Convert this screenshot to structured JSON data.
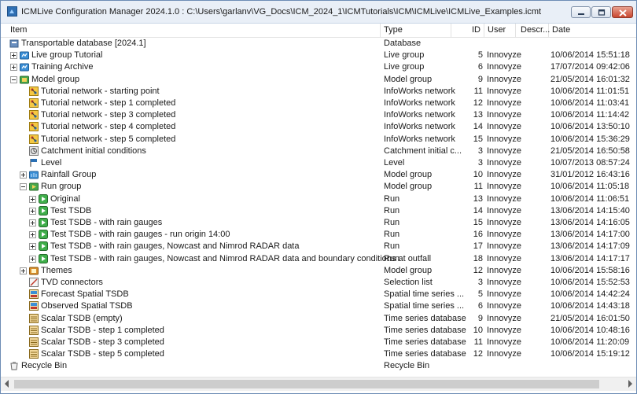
{
  "window": {
    "title": "ICMLive Configuration Manager 2024.1.0 : C:\\Users\\garlanv\\VG_Docs\\ICM_2024_1\\ICMTutorials\\ICM\\ICMLive\\ICMLive_Examples.icmt"
  },
  "columns": {
    "item": "Item",
    "type": "Type",
    "id": "ID",
    "user": "User",
    "description": "Descr...",
    "date": "Date"
  },
  "rows": [
    {
      "indent": 0,
      "expander": "none",
      "icon": "database-icon",
      "name": "Transportable database [2024.1]",
      "type": "Database",
      "id": "",
      "user": "",
      "date": ""
    },
    {
      "indent": 0,
      "expander": "plus",
      "icon": "live-group-icon",
      "name": "Live group Tutorial",
      "type": "Live group",
      "id": "5",
      "user": "Innovyze",
      "date": "10/06/2014 15:51:18"
    },
    {
      "indent": 0,
      "expander": "plus",
      "icon": "live-group-icon",
      "name": "Training Archive",
      "type": "Live group",
      "id": "6",
      "user": "Innovyze",
      "date": "17/07/2014 09:42:06"
    },
    {
      "indent": 0,
      "expander": "minus",
      "icon": "model-group-icon",
      "name": "Model group",
      "type": "Model group",
      "id": "9",
      "user": "Innovyze",
      "date": "21/05/2014 16:01:32"
    },
    {
      "indent": 1,
      "expander": "none",
      "icon": "network-icon",
      "name": "Tutorial network - starting point",
      "type": "InfoWorks network",
      "id": "11",
      "user": "Innovyze",
      "date": "10/06/2014 11:01:51"
    },
    {
      "indent": 1,
      "expander": "none",
      "icon": "network-icon",
      "name": "Tutorial network - step 1 completed",
      "type": "InfoWorks network",
      "id": "12",
      "user": "Innovyze",
      "date": "10/06/2014 11:03:41"
    },
    {
      "indent": 1,
      "expander": "none",
      "icon": "network-icon",
      "name": "Tutorial network - step 3 completed",
      "type": "InfoWorks network",
      "id": "13",
      "user": "Innovyze",
      "date": "10/06/2014 11:14:42"
    },
    {
      "indent": 1,
      "expander": "none",
      "icon": "network-icon",
      "name": "Tutorial network - step 4 completed",
      "type": "InfoWorks network",
      "id": "14",
      "user": "Innovyze",
      "date": "10/06/2014 13:50:10"
    },
    {
      "indent": 1,
      "expander": "none",
      "icon": "network-icon",
      "name": "Tutorial network - step 5 completed",
      "type": "InfoWorks network",
      "id": "15",
      "user": "Innovyze",
      "date": "10/06/2014 15:36:29"
    },
    {
      "indent": 1,
      "expander": "none",
      "icon": "catchment-icon",
      "name": "Catchment initial conditions",
      "type": "Catchment initial c...",
      "id": "3",
      "user": "Innovyze",
      "date": "21/05/2014 16:50:58"
    },
    {
      "indent": 1,
      "expander": "none",
      "icon": "level-icon",
      "name": "Level",
      "type": "Level",
      "id": "3",
      "user": "Innovyze",
      "date": "10/07/2013 08:57:24"
    },
    {
      "indent": 1,
      "expander": "plus",
      "icon": "rainfall-group-icon",
      "name": "Rainfall Group",
      "type": "Model group",
      "id": "10",
      "user": "Innovyze",
      "date": "31/01/2012 16:43:16"
    },
    {
      "indent": 1,
      "expander": "minus",
      "icon": "run-group-icon",
      "name": "Run group",
      "type": "Model group",
      "id": "11",
      "user": "Innovyze",
      "date": "10/06/2014 11:05:18"
    },
    {
      "indent": 2,
      "expander": "plus",
      "icon": "run-icon",
      "name": "Original",
      "type": "Run",
      "id": "13",
      "user": "Innovyze",
      "date": "10/06/2014 11:06:51"
    },
    {
      "indent": 2,
      "expander": "plus",
      "icon": "run-icon",
      "name": "Test TSDB",
      "type": "Run",
      "id": "14",
      "user": "Innovyze",
      "date": "13/06/2014 14:15:40"
    },
    {
      "indent": 2,
      "expander": "plus",
      "icon": "run-icon",
      "name": "Test TSDB - with rain gauges",
      "type": "Run",
      "id": "15",
      "user": "Innovyze",
      "date": "13/06/2014 14:16:05"
    },
    {
      "indent": 2,
      "expander": "plus",
      "icon": "run-icon",
      "name": "Test TSDB - with rain gauges - run origin 14:00",
      "type": "Run",
      "id": "16",
      "user": "Innovyze",
      "date": "13/06/2014 14:17:00"
    },
    {
      "indent": 2,
      "expander": "plus",
      "icon": "run-icon",
      "name": "Test TSDB - with rain gauges, Nowcast and Nimrod RADAR data",
      "type": "Run",
      "id": "17",
      "user": "Innovyze",
      "date": "13/06/2014 14:17:09"
    },
    {
      "indent": 2,
      "expander": "plus",
      "icon": "run-icon",
      "name": "Test TSDB - with rain gauges, Nowcast and Nimrod RADAR data and boundary conditions at outfall",
      "type": "Run",
      "id": "18",
      "user": "Innovyze",
      "date": "13/06/2014 14:17:17"
    },
    {
      "indent": 1,
      "expander": "plus",
      "icon": "themes-icon",
      "name": "Themes",
      "type": "Model group",
      "id": "12",
      "user": "Innovyze",
      "date": "10/06/2014 15:58:16"
    },
    {
      "indent": 1,
      "expander": "none",
      "icon": "selection-list-icon",
      "name": "TVD connectors",
      "type": "Selection list",
      "id": "3",
      "user": "Innovyze",
      "date": "10/06/2014 15:52:53"
    },
    {
      "indent": 1,
      "expander": "none",
      "icon": "spatial-tsdb-icon",
      "name": "Forecast Spatial TSDB",
      "type": "Spatial time series ...",
      "id": "5",
      "user": "Innovyze",
      "date": "10/06/2014 14:42:24"
    },
    {
      "indent": 1,
      "expander": "none",
      "icon": "spatial-tsdb-icon",
      "name": "Observed Spatial TSDB",
      "type": "Spatial time series ...",
      "id": "6",
      "user": "Innovyze",
      "date": "10/06/2014 14:43:18"
    },
    {
      "indent": 1,
      "expander": "none",
      "icon": "tsdb-icon",
      "name": "Scalar TSDB (empty)",
      "type": "Time series database",
      "id": "9",
      "user": "Innovyze",
      "date": "21/05/2014 16:01:50"
    },
    {
      "indent": 1,
      "expander": "none",
      "icon": "tsdb-icon",
      "name": "Scalar TSDB - step 1 completed",
      "type": "Time series database",
      "id": "10",
      "user": "Innovyze",
      "date": "10/06/2014 10:48:16"
    },
    {
      "indent": 1,
      "expander": "none",
      "icon": "tsdb-icon",
      "name": "Scalar TSDB - step 3 completed",
      "type": "Time series database",
      "id": "11",
      "user": "Innovyze",
      "date": "10/06/2014 11:20:09"
    },
    {
      "indent": 1,
      "expander": "none",
      "icon": "tsdb-icon",
      "name": "Scalar TSDB - step 5 completed",
      "type": "Time series database",
      "id": "12",
      "user": "Innovyze",
      "date": "10/06/2014 15:19:12"
    },
    {
      "indent": 0,
      "expander": "none",
      "icon": "recycle-bin-icon",
      "name": "Recycle Bin",
      "type": "Recycle Bin",
      "id": "",
      "user": "",
      "date": ""
    }
  ]
}
